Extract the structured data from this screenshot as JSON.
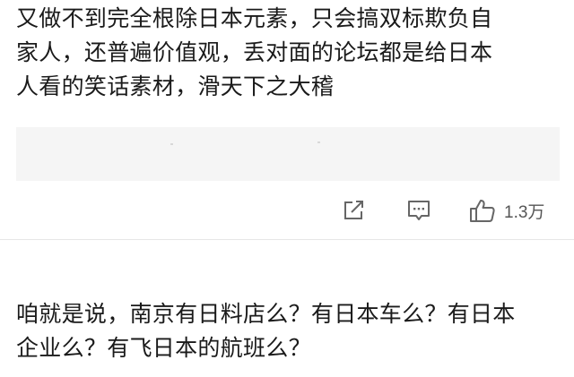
{
  "comments": [
    {
      "lines": [
        "又做不到完全根除日本元素，只会搞双标欺负自",
        "家人，还普遍价值观，丢对面的论坛都是给日本",
        "人看的笑话素材，滑天下之大稽"
      ],
      "actions": {
        "share_icon": "share-arrow-icon",
        "comment_icon": "comment-bubble-icon",
        "like_icon": "thumbs-up-icon",
        "like_count": "1.3万"
      }
    },
    {
      "lines": [
        "咱就是说，南京有日料店么？有日本车么？有日本",
        "企业么？有飞日本的航班么？"
      ]
    }
  ],
  "colors": {
    "text": "#1a1a1a",
    "icon": "#666666",
    "quote_background": "#f5f5f5",
    "divider": "#e6e6e6"
  }
}
